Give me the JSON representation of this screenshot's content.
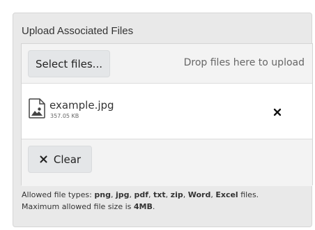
{
  "panel": {
    "title": "Upload Associated Files"
  },
  "upload": {
    "select_button_label": "Select files...",
    "drop_hint": "Drop files here to upload",
    "file": {
      "name": "example.jpg",
      "size": "357.05 KB",
      "icon": "image-file-icon",
      "remove_icon": "close-icon"
    },
    "clear_button_label": "Clear",
    "clear_icon": "close-icon"
  },
  "info": {
    "allowed_prefix": "Allowed file types: ",
    "types": [
      "png",
      "jpg",
      "pdf",
      "txt",
      "zip",
      "Word",
      "Excel"
    ],
    "allowed_suffix": " files.",
    "size_prefix": "Maximum allowed file size is ",
    "max_size": "4MB",
    "size_suffix": "."
  },
  "colors": {
    "panel_background": "#e9e9e9",
    "button_background": "#e4e6e8",
    "text_primary": "#333333",
    "text_muted": "#666666"
  }
}
